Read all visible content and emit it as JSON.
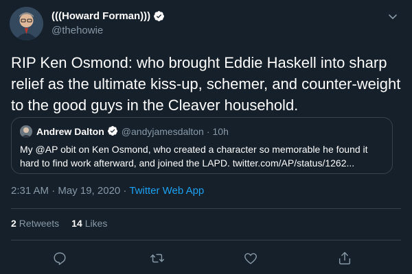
{
  "tweet": {
    "author": {
      "display_name": "(((Howard Forman)))",
      "handle": "@thehowie",
      "verified": true
    },
    "text": "RIP Ken Osmond: who brought Eddie Haskell into sharp relief as the ultimate kiss-up, schemer, and counter-weight to the good guys in the Cleaver household.",
    "quoted": {
      "display_name": "Andrew Dalton",
      "handle": "@andyjamesdalton",
      "separator": "·",
      "time": "10h",
      "text": "My @AP obit on Ken Osmond, who created a character so memorable he found it hard to find work afterward, and joined the LAPD. twitter.com/AP/status/1262..."
    },
    "timestamp": "2:31 AM · May 19, 2020 · ",
    "source": "Twitter Web App",
    "stats": {
      "retweets_count": "2",
      "retweets_label": "Retweets",
      "likes_count": "14",
      "likes_label": "Likes"
    }
  },
  "colors": {
    "background": "#15202b",
    "border": "#38444d",
    "secondary_text": "#8899a6",
    "accent": "#1da1f2",
    "verified_badge": "#ffffff"
  },
  "icons": [
    "verified-badge-icon",
    "chevron-down-icon",
    "reply-icon",
    "retweet-icon",
    "like-icon",
    "share-icon"
  ]
}
